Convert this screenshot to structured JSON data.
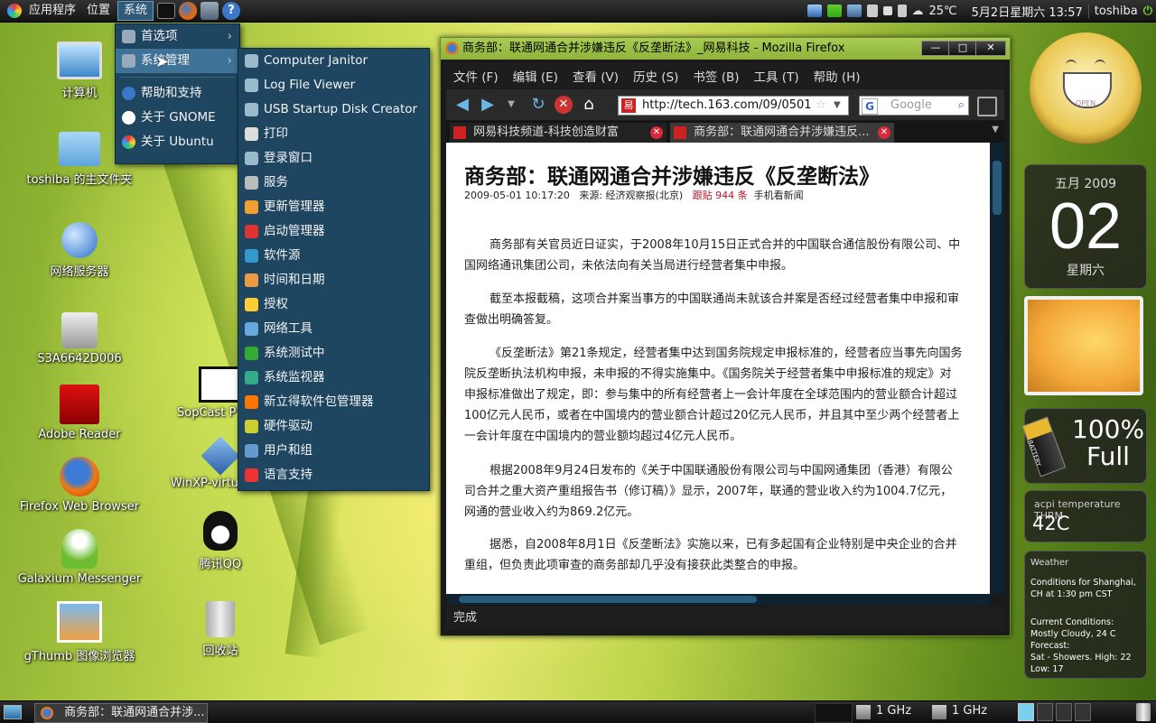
{
  "top_panel": {
    "menus": [
      "应用程序",
      "位置",
      "系统"
    ],
    "tray": {
      "temperature": "25℃",
      "datetime": "5月2日星期六 13:57",
      "user": "toshiba"
    }
  },
  "desktop_icons": [
    {
      "label": "计算机"
    },
    {
      "label": "toshiba 的主文件夹"
    },
    {
      "label": "网络服务器"
    },
    {
      "label": "S3A6642D006"
    },
    {
      "label": "Adobe Reader"
    },
    {
      "label": "Firefox Web Browser"
    },
    {
      "label": "Galaxium Messenger"
    },
    {
      "label": "gThumb 图像浏览器"
    },
    {
      "label": "SopCast P"
    },
    {
      "label": "WinXP-virtualbox"
    },
    {
      "label": "腾讯QQ"
    },
    {
      "label": "回收站"
    }
  ],
  "system_menu": {
    "items": [
      "首选项",
      "系统管理",
      "帮助和支持",
      "关于 GNOME",
      "关于 Ubuntu"
    ]
  },
  "admin_submenu": {
    "items": [
      "Computer Janitor",
      "Log File Viewer",
      "USB Startup Disk Creator",
      "打印",
      "登录窗口",
      "服务",
      "更新管理器",
      "启动管理器",
      "软件源",
      "时间和日期",
      "授权",
      "网络工具",
      "系统测试中",
      "系统监视器",
      "新立得软件包管理器",
      "硬件驱动",
      "用户和组",
      "语言支持"
    ]
  },
  "firefox": {
    "title": "商务部：联通网通合并涉嫌违反《反垄断法》_网易科技 - Mozilla Firefox",
    "menubar": [
      "文件 (F)",
      "编辑 (E)",
      "查看 (V)",
      "历史 (S)",
      "书签 (B)",
      "工具 (T)",
      "帮助 (H)"
    ],
    "url": "http://tech.163.com/09/0501",
    "search_placeholder": "Google",
    "tabs": [
      "网易科技频道-科技创造财富",
      "商务部：联通网通合并涉嫌违反..."
    ],
    "status": "完成",
    "article": {
      "headline": "商务部：联通网通合并涉嫌违反《反垄断法》",
      "meta_date": "2009-05-01 10:17:20",
      "meta_source": "来源: 经济观察报(北京)",
      "meta_follow": "跟贴 944 条",
      "meta_mobile": "手机看新闻",
      "paragraphs": [
        "商务部有关官员近日证实，于2008年10月15日正式合并的中国联合通信股份有限公司、中国网络通讯集团公司，未依法向有关当局进行经营者集中申报。",
        "截至本报截稿，这项合并案当事方的中国联通尚未就该合并案是否经过经营者集中申报和审查做出明确答复。",
        "《反垄断法》第21条规定，经营者集中达到国务院规定申报标准的，经营者应当事先向国务院反垄断执法机构申报，未申报的不得实施集中。《国务院关于经营者集中申报标准的规定》对申报标准做出了规定，即：参与集中的所有经营者上一会计年度在全球范围内的营业额合计超过100亿元人民币，或者在中国境内的营业额合计超过20亿元人民币，并且其中至少两个经营者上一会计年度在中国境内的营业额均超过4亿元人民币。",
        "根据2008年9月24日发布的《关于中国联通股份有限公司与中国网通集团（香港）有限公司合并之重大资产重组报告书（修订稿）》显示，2007年，联通的营业收入约为1004.7亿元，网通的营业收入约为869.2亿元。",
        "据悉，自2008年8月1日《反垄断法》实施以来，已有多起国有企业特别是中央企业的合并重组，但负责此项审查的商务部却几乎没有接获此类整合的申报。"
      ]
    }
  },
  "widgets": {
    "clock_label": "OPEN",
    "calendar": {
      "month": "五月 2009",
      "day": "02",
      "weekday": "星期六"
    },
    "battery": {
      "percent": "100%",
      "state": "Full",
      "label": "BATTERY"
    },
    "temperature": {
      "title": "acpi temperature THRM",
      "value": "42C"
    },
    "weather": {
      "title": "Weather",
      "conditions_for": "Conditions for Shanghai, CH at 1:30 pm CST",
      "current_label": "Current Conditions:",
      "current": "Mostly Cloudy, 24 C",
      "forecast_label": "Forecast:",
      "forecast": "Sat - Showers. High: 22 Low: 17"
    }
  },
  "taskbar": {
    "window_button": "商务部：联通网通合并涉...",
    "cpu1": "1 GHz",
    "cpu2": "1 GHz"
  }
}
